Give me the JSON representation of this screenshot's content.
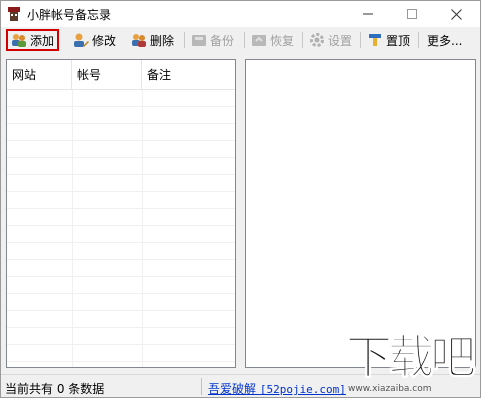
{
  "window": {
    "title": "小胖帐号备忘录",
    "controls": {
      "minimize": "—",
      "maximize": "☐",
      "close": "✕"
    }
  },
  "toolbar": {
    "items": [
      {
        "label": "添加",
        "icon": "users-add-icon",
        "enabled": true,
        "selected": true
      },
      {
        "label": "修改",
        "icon": "user-edit-icon",
        "enabled": true
      },
      {
        "label": "删除",
        "icon": "users-delete-icon",
        "enabled": true
      },
      {
        "label": "备份",
        "icon": "backup-icon",
        "enabled": false
      },
      {
        "label": "恢复",
        "icon": "restore-icon",
        "enabled": false
      },
      {
        "label": "设置",
        "icon": "gear-icon",
        "enabled": false
      },
      {
        "label": "置顶",
        "icon": "pin-top-icon",
        "enabled": true
      },
      {
        "label": "更多...",
        "enabled": true
      }
    ]
  },
  "list": {
    "columns": [
      "网站",
      "帐号",
      "备注"
    ],
    "rows": []
  },
  "status": {
    "summary": "当前共有 0 条数据",
    "link_prefix": "吾爱破解 ",
    "link_site": "[52pojie.com]"
  },
  "watermark": {
    "big": "下载吧",
    "small": "www.xiazaiba.com"
  }
}
